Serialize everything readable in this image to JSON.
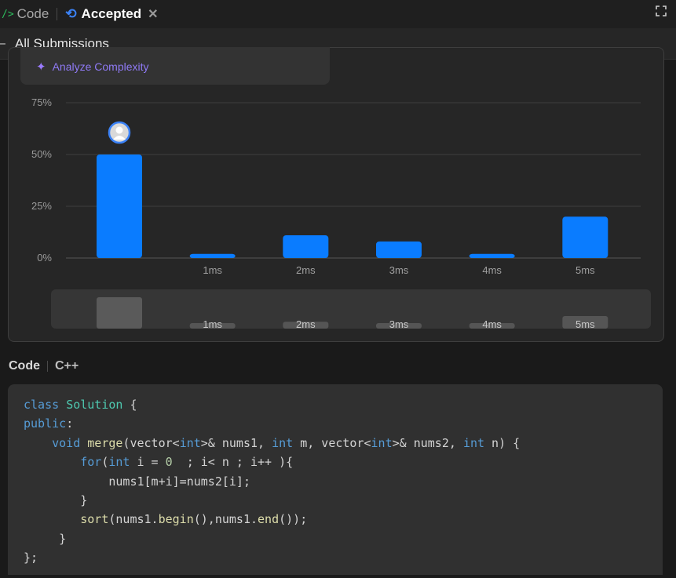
{
  "tabs": {
    "code_label": "Code",
    "accepted_label": "Accepted"
  },
  "subbar": {
    "label": "All Submissions"
  },
  "analyze": {
    "label": "Analyze Complexity"
  },
  "colors": {
    "accent": "#0a84ff",
    "accepted": "#3b82f6",
    "ai": "#8f7af5"
  },
  "chart_data": {
    "type": "bar",
    "categories": [
      "",
      "1ms",
      "2ms",
      "3ms",
      "4ms",
      "5ms"
    ],
    "values": [
      50,
      2,
      11,
      8,
      2,
      20
    ],
    "ytick_labels": [
      "75%",
      "50%",
      "25%",
      "0%"
    ],
    "yticks": [
      75,
      50,
      25,
      0
    ],
    "ylim": [
      0,
      75
    ],
    "highlight_index": 0,
    "mini_labels": [
      "",
      "1ms",
      "2ms",
      "3ms",
      "4ms",
      "5ms"
    ]
  },
  "code_header": {
    "label": "Code",
    "language": "C++"
  },
  "code_lines": [
    [
      [
        "kw",
        "class"
      ],
      [
        "pl",
        " "
      ],
      [
        "ty",
        "Solution"
      ],
      [
        "pl",
        " {"
      ]
    ],
    [
      [
        "kw",
        "public"
      ],
      [
        "pl",
        ":"
      ]
    ],
    [
      [
        "pl",
        "    "
      ],
      [
        "kw",
        "void"
      ],
      [
        "pl",
        " "
      ],
      [
        "fn",
        "merge"
      ],
      [
        "pl",
        "(vector<"
      ],
      [
        "kw",
        "int"
      ],
      [
        "pl",
        ">& nums1, "
      ],
      [
        "kw",
        "int"
      ],
      [
        "pl",
        " m, vector<"
      ],
      [
        "kw",
        "int"
      ],
      [
        "pl",
        ">& nums2, "
      ],
      [
        "kw",
        "int"
      ],
      [
        "pl",
        " n) {"
      ]
    ],
    [
      [
        "pl",
        "        "
      ],
      [
        "kw",
        "for"
      ],
      [
        "pl",
        "("
      ],
      [
        "kw",
        "int"
      ],
      [
        "pl",
        " i = "
      ],
      [
        "num",
        "0"
      ],
      [
        "pl",
        "  ; i< n ; i++ ){"
      ]
    ],
    [
      [
        "pl",
        "            nums1[m+i]=nums2[i];"
      ]
    ],
    [
      [
        "pl",
        "        }"
      ]
    ],
    [
      [
        "pl",
        "        "
      ],
      [
        "fn",
        "sort"
      ],
      [
        "pl",
        "(nums1."
      ],
      [
        "fn",
        "begin"
      ],
      [
        "pl",
        "(),nums1."
      ],
      [
        "fn",
        "end"
      ],
      [
        "pl",
        "());"
      ]
    ],
    [
      [
        "pl",
        "     }"
      ]
    ],
    [
      [
        "pl",
        "};"
      ]
    ]
  ]
}
